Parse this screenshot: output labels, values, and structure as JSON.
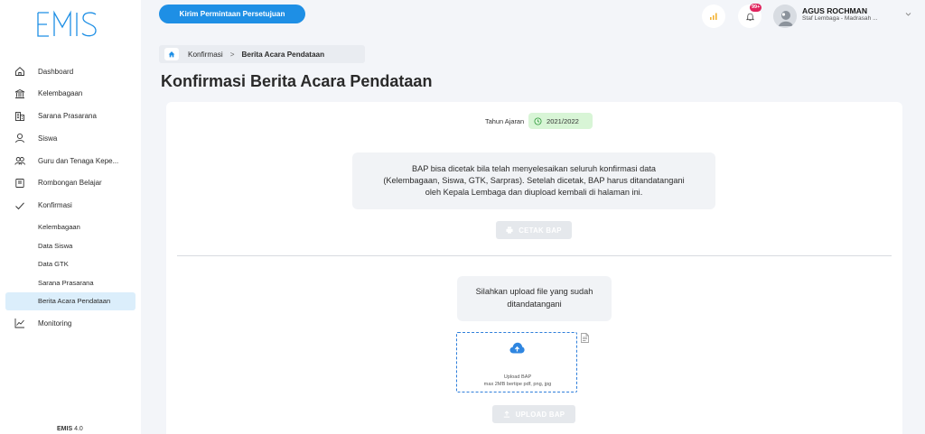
{
  "app": {
    "logo_text": "EMIS",
    "version_name": "EMIS",
    "version_number": "4.0"
  },
  "sidebar": {
    "items": [
      {
        "label": "Dashboard",
        "icon": "home-icon"
      },
      {
        "label": "Kelembagaan",
        "icon": "institution-icon"
      },
      {
        "label": "Sarana Prasarana",
        "icon": "building-icon"
      },
      {
        "label": "Siswa",
        "icon": "user-icon"
      },
      {
        "label": "Guru dan Tenaga Kepe...",
        "icon": "users-icon"
      },
      {
        "label": "Rombongan Belajar",
        "icon": "classroom-icon"
      },
      {
        "label": "Konfirmasi",
        "icon": "check-icon"
      }
    ],
    "sub_items": [
      {
        "label": "Kelembagaan"
      },
      {
        "label": "Data Siswa"
      },
      {
        "label": "Data GTK"
      },
      {
        "label": "Sarana Prasarana"
      },
      {
        "label": "Berita Acara Pendataan",
        "active": true
      }
    ],
    "monitoring": {
      "label": "Monitoring",
      "icon": "chart-line-icon"
    }
  },
  "topbar": {
    "request_button": "Kirim Permintaan Persetujuan",
    "notification_count": "99+",
    "user_name": "AGUS ROCHMAN",
    "user_role": "Staf Lembaga - Madrasah ..."
  },
  "breadcrumb": {
    "parent": "Konfirmasi",
    "separator": ">",
    "current": "Berita Acara Pendataan"
  },
  "page_title": "Konfirmasi Berita Acara Pendataan",
  "card": {
    "year_label": "Tahun Ajaran",
    "year_value": "2021/2022",
    "info_line1": "BAP bisa dicetak bila telah menyelesaikan seluruh konfirmasi data",
    "info_line2": "(Kelembagaan, Siswa, GTK, Sarpras). Setelah dicetak, BAP harus ditandatangani",
    "info_line3": "oleh Kepala Lembaga dan diupload kembali di halaman ini.",
    "print_button": "CETAK BAP",
    "upload_info": "Silahkan upload file yang sudah ditandatangani",
    "dropzone_title": "Upload BAP",
    "dropzone_hint": "max 2MB bertipe pdf, png, jpg",
    "upload_button": "UPLOAD BAP"
  },
  "colors": {
    "primary": "#1e8fe5",
    "active_bg": "#dbeefb",
    "year_badge_bg": "#d8f5d6",
    "disabled_btn": "#e5e8ec",
    "dropzone_border": "#2f7fdb"
  }
}
